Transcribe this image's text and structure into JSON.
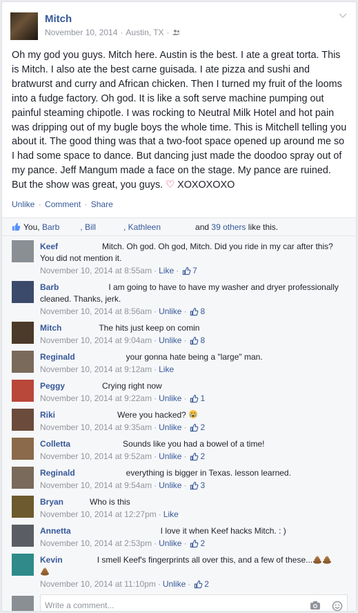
{
  "post": {
    "author": "Mitch",
    "date": "November 10, 2014",
    "location": "Austin, TX",
    "privacy_icon": "friends-icon",
    "text": "Oh my god you guys. Mitch here. Austin is the best. I ate a great torta. This is Mitch. I also ate the best carne guisada. I ate pizza and sushi and bratwurst and curry and African chicken. Then I turned my fruit of the looms into a fudge factory. Oh god. It is like a soft serve machine pumping out painful steaming chipotle. I was rocking to Neutral Milk Hotel and hot pain was dripping out of my bugle boys the whole time. This is Mitchell telling you about it. The good thing was that a two-foot space opened up around me so I had some space to dance. But dancing just made the doodoo spray out of my pance. Jeff Mangum made a face on the stage. My pance are ruined. But the show was great, you guys.",
    "text_end": "XOXOXOXO",
    "actions": {
      "unlike": "Unlike",
      "comment": "Comment",
      "share": "Share"
    }
  },
  "likes": {
    "you": "You,",
    "names": [
      "Barb",
      ", Bill",
      ", Kathleen"
    ],
    "and": "and",
    "others": "39 others",
    "suffix": "like this."
  },
  "comments": [
    {
      "name": "Keef",
      "text": "Mitch. Oh god. Oh god, Mitch. Did you ride in my car after this? You did not mention it.",
      "time": "November 10, 2014 at 8:55am",
      "action": "Like",
      "likes": "7",
      "avatar": "#8a8f94"
    },
    {
      "name": "Barb",
      "text": "I am going to have to have my washer and dryer professionally cleaned. Thanks, jerk.",
      "time": "November 10, 2014 at 8:56am",
      "action": "Unlike",
      "likes": "8",
      "avatar": "#3b4a6b"
    },
    {
      "name": "Mitch",
      "text": "The hits just keep on comin",
      "time": "November 10, 2014 at 9:04am",
      "action": "Unlike",
      "likes": "8",
      "avatar": "#4b3a29"
    },
    {
      "name": "Reginald",
      "text": "your gonna hate being a \"large\" man.",
      "time": "November 10, 2014 at 9:12am",
      "action": "Like",
      "likes": "",
      "avatar": "#7a6a5a"
    },
    {
      "name": "Peggy",
      "text": "Crying right now",
      "time": "November 10, 2014 at 9:22am",
      "action": "Unlike",
      "likes": "1",
      "avatar": "#b9473a"
    },
    {
      "name": "Riki",
      "text": "Were you hacked?",
      "time": "November 10, 2014 at 9:35am",
      "action": "Unlike",
      "likes": "2",
      "avatar": "#6b4b3b",
      "emoji": "crying-face-icon"
    },
    {
      "name": "Colletta",
      "text": "Sounds like you had a bowel of a time!",
      "time": "November 10, 2014 at 9:52am",
      "action": "Unlike",
      "likes": "2",
      "avatar": "#8a6a4a"
    },
    {
      "name": "Reginald",
      "text": "everything is bigger in Texas. lesson learned.",
      "time": "November 10, 2014 at 9:54am",
      "action": "Unlike",
      "likes": "3",
      "avatar": "#7a6a5a"
    },
    {
      "name": "Bryan",
      "text": "Who is this",
      "time": "November 10, 2014 at 12:27pm",
      "action": "Like",
      "likes": "",
      "avatar": "#6d5a2e"
    },
    {
      "name": "Annetta",
      "text": "I love it when Keef hacks Mitch. : )",
      "time": "November 10, 2014 at 2:53pm",
      "action": "Unlike",
      "likes": "2",
      "avatar": "#5a5d64"
    },
    {
      "name": "Kevin",
      "text": "I smell Keef's fingerprints all over this, and a few of these...",
      "time": "November 10, 2014 at 11:10pm",
      "action": "Unlike",
      "likes": "2",
      "avatar": "#2f8a8a",
      "emoji": "pile-of-poo-icon"
    }
  ],
  "reply": {
    "placeholder": "Write a comment...",
    "camera_icon": "camera-icon",
    "emoji_icon": "smiley-icon"
  },
  "colors": {
    "link": "#365899",
    "meta": "#90949c",
    "heart": "#e0245e",
    "background": "#f6f7f9"
  }
}
